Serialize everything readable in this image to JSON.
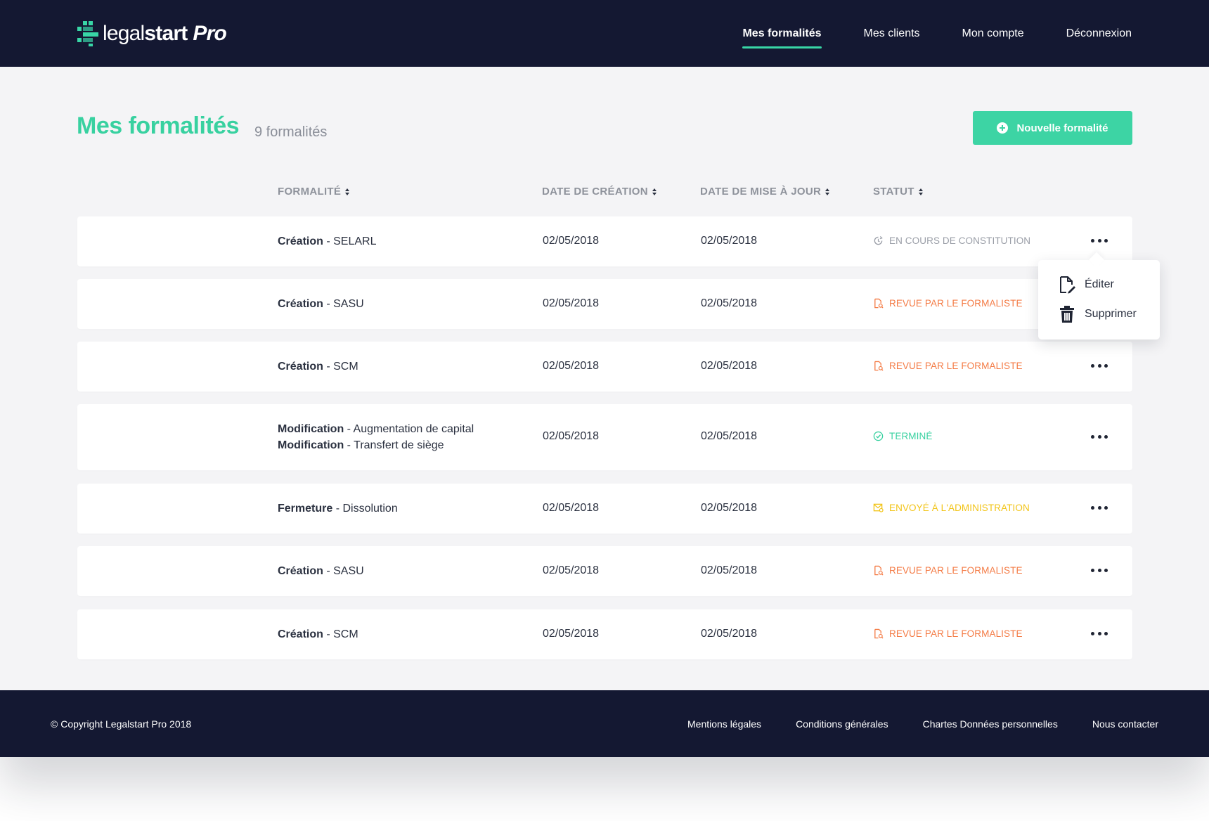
{
  "header": {
    "logo": {
      "light": "legal",
      "bold": "start",
      "pro": "Pro"
    },
    "nav": [
      {
        "label": "Mes formalités",
        "active": true
      },
      {
        "label": "Mes clients",
        "active": false
      },
      {
        "label": "Mon compte",
        "active": false
      },
      {
        "label": "Déconnexion",
        "active": false
      }
    ]
  },
  "page": {
    "title": "Mes formalités",
    "count": "9 formalités",
    "new_button": "Nouvelle formalité"
  },
  "table": {
    "columns": {
      "formalite": "FORMALITÉ",
      "creation": "DATE DE CRÉATION",
      "update": "DATE DE MISE À JOUR",
      "status": "STATUT"
    },
    "rows": [
      {
        "lines": [
          {
            "type": "Création",
            "detail": " - SELARL"
          }
        ],
        "created": "02/05/2018",
        "updated": "02/05/2018",
        "status": "EN COURS DE CONSTITUTION",
        "status_kind": "progress"
      },
      {
        "lines": [
          {
            "type": "Création",
            "detail": " - SASU"
          }
        ],
        "created": "02/05/2018",
        "updated": "02/05/2018",
        "status": "REVUE PAR LE FORMALISTE",
        "status_kind": "review"
      },
      {
        "lines": [
          {
            "type": "Création",
            "detail": " - SCM"
          }
        ],
        "created": "02/05/2018",
        "updated": "02/05/2018",
        "status": "REVUE PAR LE FORMALISTE",
        "status_kind": "review"
      },
      {
        "lines": [
          {
            "type": "Modification",
            "detail": " - Augmentation de capital"
          },
          {
            "type": "Modification",
            "detail": " - Transfert de siège"
          }
        ],
        "created": "02/05/2018",
        "updated": "02/05/2018",
        "status": "TERMINÉ",
        "status_kind": "done"
      },
      {
        "lines": [
          {
            "type": "Fermeture",
            "detail": " - Dissolution"
          }
        ],
        "created": "02/05/2018",
        "updated": "02/05/2018",
        "status": "ENVOYÉ À L'ADMINISTRATION",
        "status_kind": "sent"
      },
      {
        "lines": [
          {
            "type": "Création",
            "detail": " - SASU"
          }
        ],
        "created": "02/05/2018",
        "updated": "02/05/2018",
        "status": "REVUE PAR LE FORMALISTE",
        "status_kind": "review"
      },
      {
        "lines": [
          {
            "type": "Création",
            "detail": " - SCM"
          }
        ],
        "created": "02/05/2018",
        "updated": "02/05/2018",
        "status": "REVUE PAR LE FORMALISTE",
        "status_kind": "review"
      }
    ]
  },
  "status_colors": {
    "progress": "#9a9ea7",
    "review": "#f47b45",
    "done": "#38d1a0",
    "sent": "#f2c418"
  },
  "row_menu": {
    "edit": "Éditer",
    "delete": "Supprimer"
  },
  "footer": {
    "copyright": "© Copyright Legalstart Pro 2018",
    "links": [
      "Mentions légales",
      "Conditions générales",
      "Chartes Données personnelles",
      "Nous contacter"
    ]
  }
}
